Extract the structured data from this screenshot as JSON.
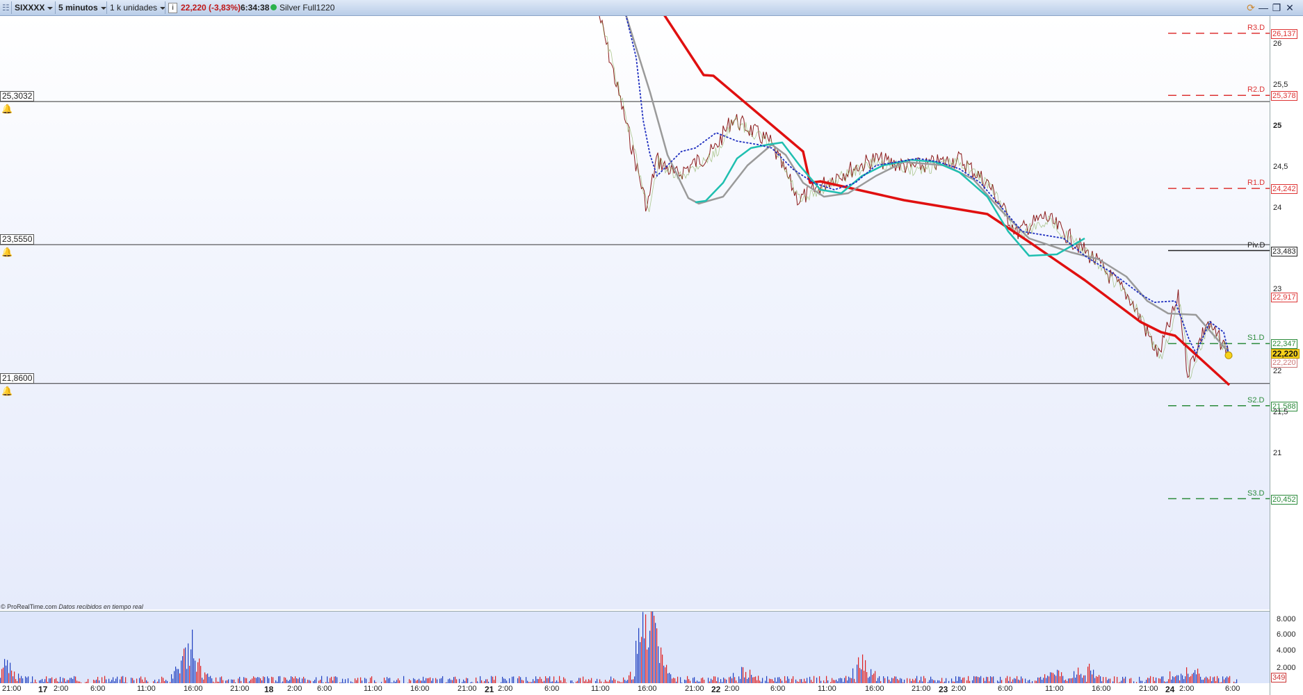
{
  "toolbar": {
    "symbol": "SIXXXX",
    "interval": "5 minutos",
    "units": "1 k unidades",
    "info_icon": "info-icon",
    "price_change": "22,220 (-3,83%)",
    "time": "6:34:38",
    "status_dot_color": "#2bb24c",
    "account": "Silver Full1220"
  },
  "alerts": [
    {
      "label": "25,3032",
      "value": 25.3032
    },
    {
      "label": "23,5550",
      "value": 23.555
    },
    {
      "label": "21,8600",
      "value": 21.86
    }
  ],
  "pivots": [
    {
      "name": "R3.D",
      "value_label": "26,137",
      "value": 26.137,
      "color": "#d33"
    },
    {
      "name": "R2.D",
      "value_label": "25,378",
      "value": 25.378,
      "color": "#d33"
    },
    {
      "name": "R1.D",
      "value_label": "24,242",
      "value": 24.242,
      "color": "#d33"
    },
    {
      "name": "Piv.D",
      "value_label": "23,483",
      "value": 23.483,
      "color": "#222"
    },
    {
      "name": "S1.D",
      "value_label": "22,347",
      "value": 22.347,
      "color": "#2a8a3a"
    },
    {
      "name": "S2.D",
      "value_label": "21,588",
      "value": 21.588,
      "color": "#2a8a3a"
    },
    {
      "name": "S3.D",
      "value_label": "20,452",
      "value": 20.452,
      "color": "#2a8a3a"
    }
  ],
  "price_axis": {
    "ticks": [
      {
        "label": "26",
        "value": 26
      },
      {
        "label": "25,5",
        "value": 25.5
      },
      {
        "label": "25",
        "value": 25,
        "bold": true
      },
      {
        "label": "24,5",
        "value": 24.5
      },
      {
        "label": "24",
        "value": 24
      },
      {
        "label": "23",
        "value": 23
      },
      {
        "label": "22",
        "value": 22
      },
      {
        "label": "21,5",
        "value": 21.5
      },
      {
        "label": "21",
        "value": 21
      }
    ],
    "current_price_label": "22,220",
    "current_price": 22.22,
    "ma_label": "22,917",
    "ma_value": 22.917,
    "bg_label": "22,220"
  },
  "volume_axis": {
    "ticks": [
      "8.000",
      "6.000",
      "4.000",
      "2.000"
    ],
    "last_value": "349"
  },
  "time_axis": [
    {
      "label": "21:00"
    },
    {
      "label": "17",
      "bold": true
    },
    {
      "label": "2:00"
    },
    {
      "label": "6:00"
    },
    {
      "label": "11:00"
    },
    {
      "label": "16:00"
    },
    {
      "label": "21:00"
    },
    {
      "label": "18",
      "bold": true
    },
    {
      "label": "2:00"
    },
    {
      "label": "6:00"
    },
    {
      "label": "11:00"
    },
    {
      "label": "16:00"
    },
    {
      "label": "21:00"
    },
    {
      "label": "21",
      "bold": true
    },
    {
      "label": "2:00"
    },
    {
      "label": "6:00"
    },
    {
      "label": "11:00"
    },
    {
      "label": "16:00"
    },
    {
      "label": "21:00"
    },
    {
      "label": "22",
      "bold": true
    },
    {
      "label": "2:00"
    },
    {
      "label": "6:00"
    },
    {
      "label": "11:00"
    },
    {
      "label": "16:00"
    },
    {
      "label": "21:00"
    },
    {
      "label": "23",
      "bold": true
    },
    {
      "label": "2:00"
    },
    {
      "label": "6:00"
    },
    {
      "label": "11:00"
    },
    {
      "label": "16:00"
    },
    {
      "label": "21:00"
    },
    {
      "label": "24",
      "bold": true
    },
    {
      "label": "2:00"
    },
    {
      "label": "6:00"
    }
  ],
  "copyright": {
    "brand": "© ProRealTime.com",
    "note": "Datos recibidos en tiempo real"
  },
  "colors": {
    "price_line": "#8b1a1a",
    "ma_red": "#e01010",
    "ma_teal": "#1fbfb0",
    "ma_grey": "#9a9a9a",
    "ma_blue_dotted": "#2030c0",
    "volume_up": "#2040c0",
    "volume_down": "#e02020"
  },
  "chart_data": {
    "type": "line",
    "title": "",
    "x_unit": "time",
    "series": [
      {
        "values_desc": "price",
        "points": [
          [
            "21 16:00",
            26.2
          ],
          [
            "21 17:00",
            24.0
          ],
          [
            "21 18:00",
            24.6
          ],
          [
            "21 20:00",
            24.4
          ],
          [
            "22 0:00",
            24.7
          ],
          [
            "22 2:00",
            25.1
          ],
          [
            "22 6:00",
            24.8
          ],
          [
            "22 9:00",
            24.1
          ],
          [
            "22 13:00",
            24.4
          ],
          [
            "22 17:00",
            24.6
          ],
          [
            "22 21:00",
            24.5
          ],
          [
            "23 2:00",
            24.6
          ],
          [
            "23 5:00",
            24.3
          ],
          [
            "23 8:00",
            23.7
          ],
          [
            "23 11:00",
            23.9
          ],
          [
            "23 16:00",
            23.4
          ],
          [
            "23 20:00",
            22.9
          ],
          [
            "23 23:00",
            22.2
          ],
          [
            "24 1:00",
            22.9
          ],
          [
            "24 2:00",
            22.0
          ],
          [
            "24 4:00",
            22.6
          ],
          [
            "24 6:30",
            22.22
          ]
        ]
      }
    ],
    "ylim": [
      20.3,
      26.4
    ]
  }
}
